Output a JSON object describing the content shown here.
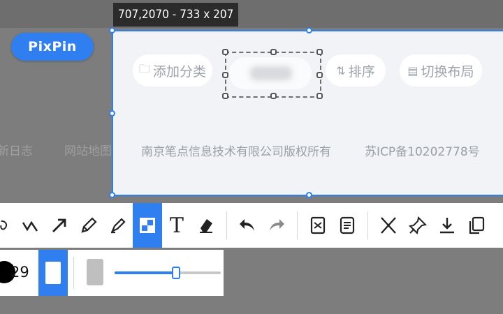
{
  "size_tip": "707,2070 - 733 x 207",
  "logo": "PixPin",
  "backdrop": {
    "changelog_fragment": "新日志",
    "sitemap": "网站地图"
  },
  "selection": {
    "add_category": "添加分类",
    "sort": "排序",
    "switch_layout": "切换布局",
    "copyright": "南京笔点信息技术有限公司版权所有",
    "icp": "苏ICP备10202778号"
  },
  "toolbar": {
    "tools": [
      "lasso",
      "polyline",
      "arrow",
      "pencil",
      "highlighter",
      "mosaic",
      "text",
      "eraser",
      "undo",
      "redo",
      "pin-to-top",
      "ocr",
      "cancel",
      "pin",
      "save",
      "copy"
    ],
    "active_tool": "mosaic",
    "text_tool_glyph": "T"
  },
  "subbar": {
    "brush_size": "29",
    "opacity_fraction": 0.58,
    "accent": "#2f7ff0"
  }
}
